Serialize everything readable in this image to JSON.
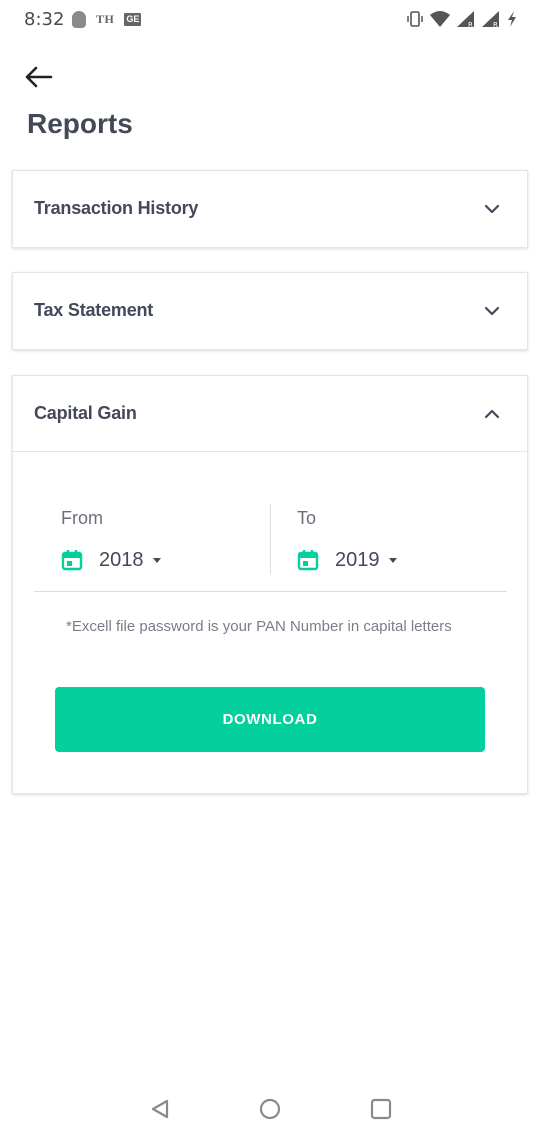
{
  "status_bar": {
    "time": "8:32",
    "carrier_badge": "TH",
    "ge_badge": "GE"
  },
  "header": {
    "back_icon": "arrow-left-icon",
    "title": "Reports"
  },
  "sections": {
    "transaction_history": {
      "title": "Transaction History",
      "expanded": false
    },
    "tax_statement": {
      "title": "Tax Statement",
      "expanded": false
    },
    "capital_gain": {
      "title": "Capital Gain",
      "expanded": true,
      "from_label": "From",
      "from_year": "2018",
      "to_label": "To",
      "to_year": "2019",
      "note": "*Excell file password is your PAN Number in capital letters",
      "download_label": "DOWNLOAD"
    }
  },
  "colors": {
    "accent": "#03d09d",
    "title_text": "#44495a",
    "muted_text": "#7a7e89"
  }
}
